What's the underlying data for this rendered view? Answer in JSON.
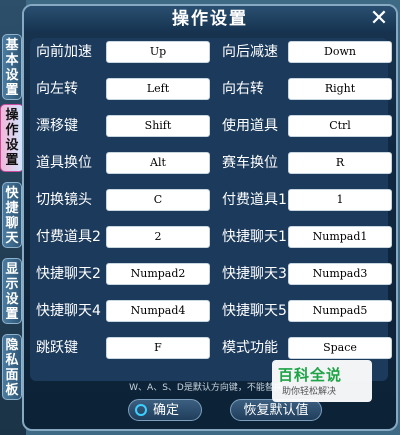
{
  "window": {
    "title": "操作设置",
    "close_label": "✕"
  },
  "side_tabs": [
    {
      "label": "基本设置",
      "active": false
    },
    {
      "label": "操作设置",
      "active": true
    },
    {
      "label": "快捷聊天",
      "active": false
    },
    {
      "label": "显示设置",
      "active": false
    },
    {
      "label": "隐私面板",
      "active": false
    }
  ],
  "settings": [
    {
      "left_label": "向前加速",
      "left_key": "Up",
      "right_label": "向后减速",
      "right_key": "Down"
    },
    {
      "left_label": "向左转",
      "left_key": "Left",
      "right_label": "向右转",
      "right_key": "Right"
    },
    {
      "left_label": "漂移键",
      "left_key": "Shift",
      "right_label": "使用道具",
      "right_key": "Ctrl"
    },
    {
      "left_label": "道具换位",
      "left_key": "Alt",
      "right_label": "赛车换位",
      "right_key": "R"
    },
    {
      "left_label": "切换镜头",
      "left_key": "C",
      "right_label": "付费道具1",
      "right_key": "1"
    },
    {
      "left_label": "付费道具2",
      "left_key": "2",
      "right_label": "快捷聊天1",
      "right_key": "Numpad1"
    },
    {
      "left_label": "快捷聊天2",
      "left_key": "Numpad2",
      "right_label": "快捷聊天3",
      "right_key": "Numpad3"
    },
    {
      "left_label": "快捷聊天4",
      "left_key": "Numpad4",
      "right_label": "快捷聊天5",
      "right_key": "Numpad5"
    },
    {
      "left_label": "跳跃键",
      "left_key": "F",
      "right_label": "模式功能",
      "right_key": "Space"
    }
  ],
  "note": "W、A、S、D是默认方向键，不能替换",
  "footer": {
    "ok_label": "确定",
    "reset_label": "恢复默认值"
  },
  "watermark": {
    "title": "百科全说",
    "subtitle": "助你轻松解决"
  }
}
